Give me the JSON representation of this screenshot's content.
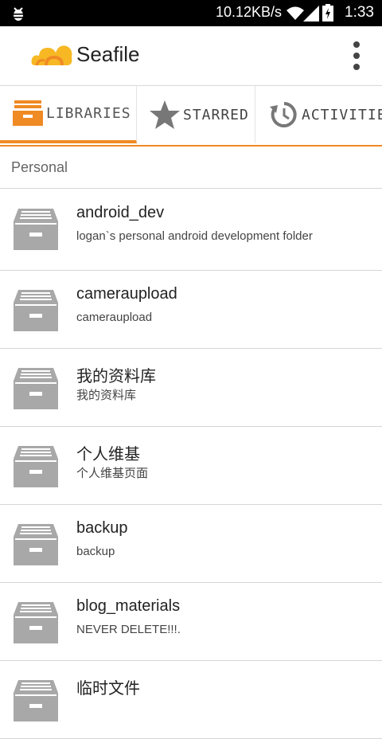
{
  "status_bar": {
    "network_speed": "10.12KB/s",
    "time": "1:33",
    "icons": [
      "bug-icon",
      "wifi-icon",
      "signal-icon",
      "battery-charging-icon"
    ]
  },
  "app_bar": {
    "title": "Seafile",
    "logo_icon": "seafile-cloud-logo",
    "menu_icon": "overflow-menu-icon"
  },
  "tabs": [
    {
      "label": "LIBRARIES",
      "icon": "library-icon",
      "active": true
    },
    {
      "label": "STARRED",
      "icon": "star-icon",
      "active": false
    },
    {
      "label": "ACTIVITIES",
      "icon": "history-icon",
      "active": false
    }
  ],
  "section": {
    "title": "Personal"
  },
  "libraries": [
    {
      "name": "android_dev",
      "description": "logan`s personal android development folder"
    },
    {
      "name": "cameraupload",
      "description": "cameraupload"
    },
    {
      "name": "我的资料库",
      "description": "我的资料库"
    },
    {
      "name": "个人维基",
      "description": "个人维基页面"
    },
    {
      "name": "backup",
      "description": "backup"
    },
    {
      "name": "blog_materials",
      "description": "NEVER DELETE!!!."
    },
    {
      "name": "临时文件",
      "description": ""
    }
  ],
  "colors": {
    "accent": "#f08a24",
    "icon_gray": "#a8a8a8"
  }
}
